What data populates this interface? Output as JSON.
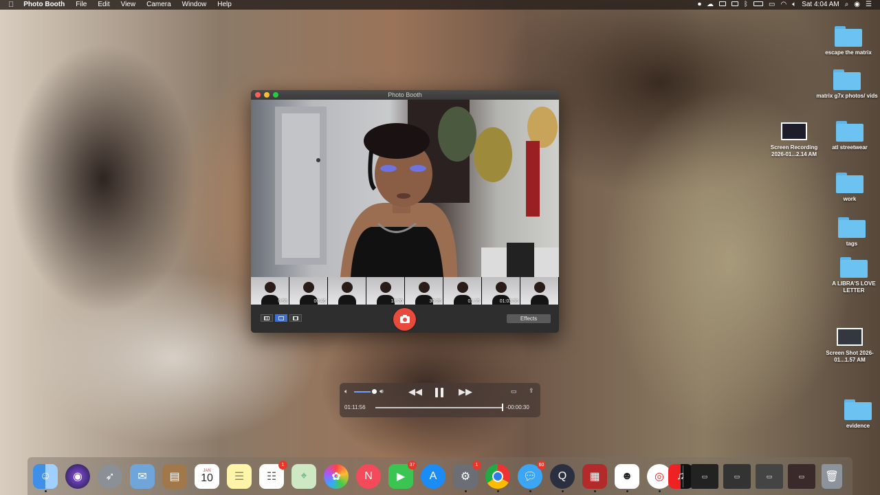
{
  "menubar": {
    "app_name": "Photo Booth",
    "menus": [
      "File",
      "Edit",
      "View",
      "Camera",
      "Window",
      "Help"
    ],
    "clock": "Sat 4:04 AM"
  },
  "desktop": {
    "items": [
      {
        "label": "escape the matrix",
        "kind": "folder"
      },
      {
        "label": "matrix g7x photos/ vids",
        "kind": "folder"
      },
      {
        "label": "Screen Recording 2026-01...2.14 AM",
        "kind": "screenshot"
      },
      {
        "label": "atl streetwear",
        "kind": "folder"
      },
      {
        "label": "work",
        "kind": "folder"
      },
      {
        "label": "tags",
        "kind": "folder"
      },
      {
        "label": "A LIBRA'S LOVE LETTER",
        "kind": "folder"
      },
      {
        "label": "Screen Shot 2026-01...1.57 AM",
        "kind": "screenshot"
      },
      {
        "label": "evidence",
        "kind": "folder"
      }
    ]
  },
  "photobooth": {
    "title": "Photo Booth",
    "thumbs": [
      {
        "duration": "0:58"
      },
      {
        "duration": "00:46"
      },
      {
        "duration": ""
      },
      {
        "duration": "18:20"
      },
      {
        "duration": "30:26"
      },
      {
        "duration": "01:15"
      },
      {
        "duration": "01:03:36"
      },
      {
        "duration": ""
      }
    ],
    "effects_label": "Effects"
  },
  "player": {
    "elapsed": "01:11:56",
    "remaining": "-00:00:30",
    "progress_fraction": 0.99,
    "volume_fraction": 0.8
  },
  "dock": {
    "apps": [
      {
        "name": "Finder",
        "badge": ""
      },
      {
        "name": "Siri",
        "badge": ""
      },
      {
        "name": "Launchpad",
        "badge": ""
      },
      {
        "name": "Preview",
        "badge": ""
      },
      {
        "name": "Contacts",
        "badge": ""
      },
      {
        "name": "Calendar",
        "badge": "",
        "month": "JAN",
        "day": "10"
      },
      {
        "name": "Notes",
        "badge": ""
      },
      {
        "name": "Reminders",
        "badge": "1"
      },
      {
        "name": "Maps",
        "badge": ""
      },
      {
        "name": "Photos",
        "badge": ""
      },
      {
        "name": "News",
        "badge": ""
      },
      {
        "name": "FaceTime",
        "badge": "37"
      },
      {
        "name": "App Store",
        "badge": ""
      },
      {
        "name": "System Preferences",
        "badge": "1"
      },
      {
        "name": "Chrome",
        "badge": ""
      },
      {
        "name": "Messages",
        "badge": "60"
      },
      {
        "name": "QuickTime Player",
        "badge": ""
      },
      {
        "name": "Photo Booth",
        "badge": ""
      },
      {
        "name": "Discord",
        "badge": ""
      },
      {
        "name": "Scrobbles",
        "badge": ""
      },
      {
        "name": "Music",
        "badge": ""
      }
    ]
  }
}
